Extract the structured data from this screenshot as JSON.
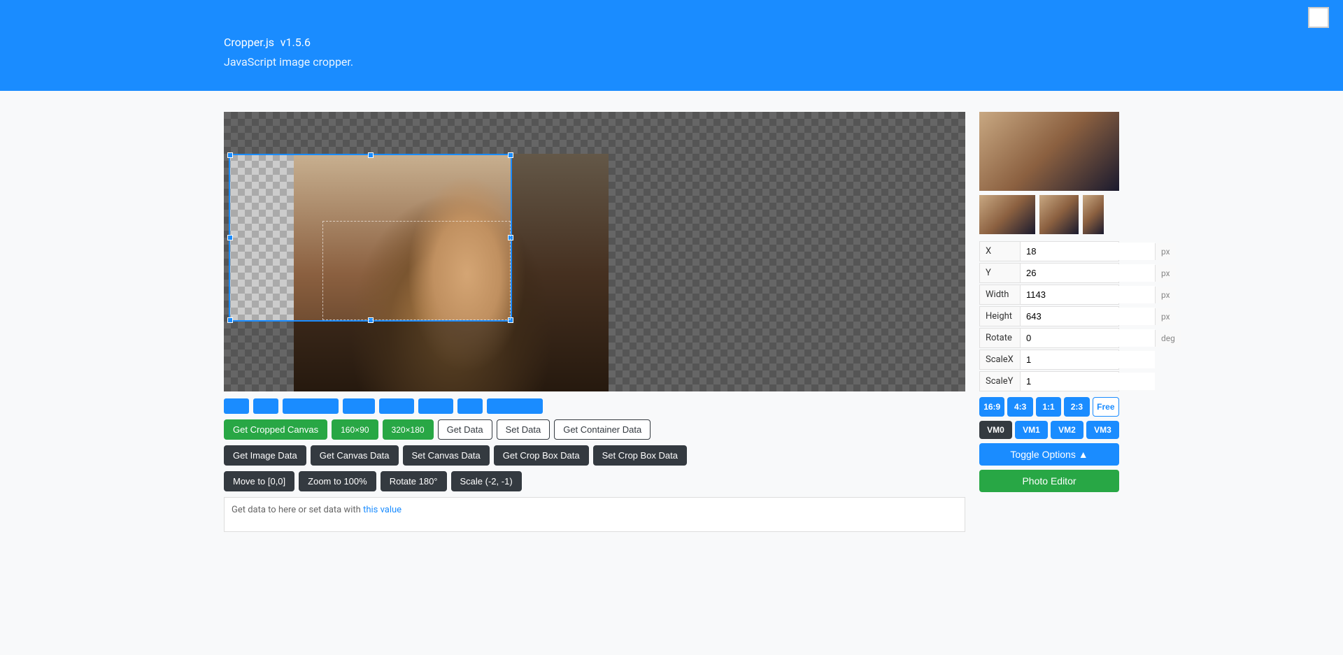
{
  "header": {
    "title": "Cropper.js",
    "version": "v1.5.6",
    "subtitle": "JavaScript image cropper."
  },
  "toolbar": {
    "btn1_width": 36,
    "btn2_width": 36,
    "btn3_width": 80,
    "btn4_width": 46,
    "btn5_width": 50,
    "btn6_width": 50,
    "btn7_width": 36,
    "btn8_width": 80
  },
  "buttons_row1": {
    "get_cropped_canvas": "Get Cropped Canvas",
    "size_160": "160×90",
    "size_320": "320×180",
    "get_data": "Get Data",
    "set_data": "Set Data",
    "get_container_data": "Get Container Data"
  },
  "buttons_row2": {
    "get_image_data": "Get Image Data",
    "get_canvas_data": "Get Canvas Data",
    "set_canvas_data": "Set Canvas Data",
    "get_crop_box_data": "Get Crop Box Data",
    "set_crop_box_data": "Set Crop Box Data"
  },
  "buttons_row3": {
    "move": "Move to [0,0]",
    "zoom": "Zoom to 100%",
    "rotate": "Rotate 180°",
    "scale": "Scale (-2, -1)"
  },
  "textarea": {
    "placeholder_text": "Get data to here or set data with",
    "link_text": "this value",
    "suffix": ""
  },
  "fields": {
    "x_label": "X",
    "x_value": "18",
    "x_unit": "px",
    "y_label": "Y",
    "y_value": "26",
    "y_unit": "px",
    "width_label": "Width",
    "width_value": "1143",
    "width_unit": "px",
    "height_label": "Height",
    "height_value": "643",
    "height_unit": "px",
    "rotate_label": "Rotate",
    "rotate_value": "0",
    "rotate_unit": "deg",
    "scalex_label": "ScaleX",
    "scalex_value": "1",
    "scaley_label": "ScaleY",
    "scaley_value": "1"
  },
  "ratios": {
    "r1": "16:9",
    "r2": "4:3",
    "r3": "1:1",
    "r4": "2:3",
    "r5": "Free"
  },
  "vm_buttons": {
    "vm0": "VM0",
    "vm1": "VM1",
    "vm2": "VM2",
    "vm3": "VM3"
  },
  "toggle_label": "Toggle Options ▲",
  "photo_editor_label": "Photo Editor"
}
